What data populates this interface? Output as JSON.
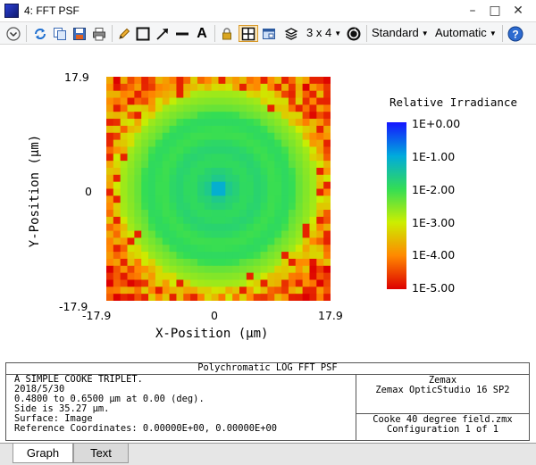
{
  "window": {
    "title": "4: FFT PSF",
    "minimize": "–",
    "maximize": "□",
    "close": "✕"
  },
  "toolbar": {
    "text_tool": "A",
    "layout_label": "3 x 4",
    "standard_label": "Standard",
    "automatic_label": "Automatic",
    "icons": [
      "chevron-down-circle-icon",
      "refresh-icon",
      "copy-icon",
      "save-icon",
      "print-icon",
      "pencil-icon",
      "rectangle-icon",
      "arrow-icon",
      "line-icon",
      "text-icon",
      "lock-icon",
      "grid-layout-icon",
      "window-icon",
      "layers-icon",
      "clock-refresh-icon",
      "help-icon"
    ]
  },
  "plot": {
    "x_axis_title": "X-Position (µm)",
    "y_axis_title": "Y-Position (µm)",
    "x_ticks": [
      "-17.9",
      "0",
      "17.9"
    ],
    "y_ticks": [
      "17.9",
      "0",
      "-17.9"
    ],
    "colorbar_title": "Relative Irradiance",
    "colorbar_ticks": [
      "1E+0.00",
      "1E-1.00",
      "1E-2.00",
      "1E-3.00",
      "1E-4.00",
      "1E-5.00"
    ],
    "colors": {
      "max": "#1a1aff",
      "mid": "#22cc55",
      "low": "#ddee00",
      "min": "#dd0000"
    }
  },
  "info": {
    "title": "Polychromatic LOG FFT PSF",
    "left_lines": [
      "A SIMPLE COOKE TRIPLET.",
      "2018/5/30",
      "0.4800 to 0.6500 µm at 0.00 (deg).",
      "Side is 35.27 µm.",
      "Surface: Image",
      "Reference Coordinates: 0.00000E+00, 0.00000E+00"
    ],
    "right_top_lines": [
      "Zemax",
      "Zemax OpticStudio 16 SP2"
    ],
    "right_bottom_lines": [
      "Cooke 40 degree field.zmx",
      "Configuration 1 of 1"
    ]
  },
  "tabs": [
    {
      "label": "Graph",
      "active": true
    },
    {
      "label": "Text",
      "active": false
    }
  ]
}
